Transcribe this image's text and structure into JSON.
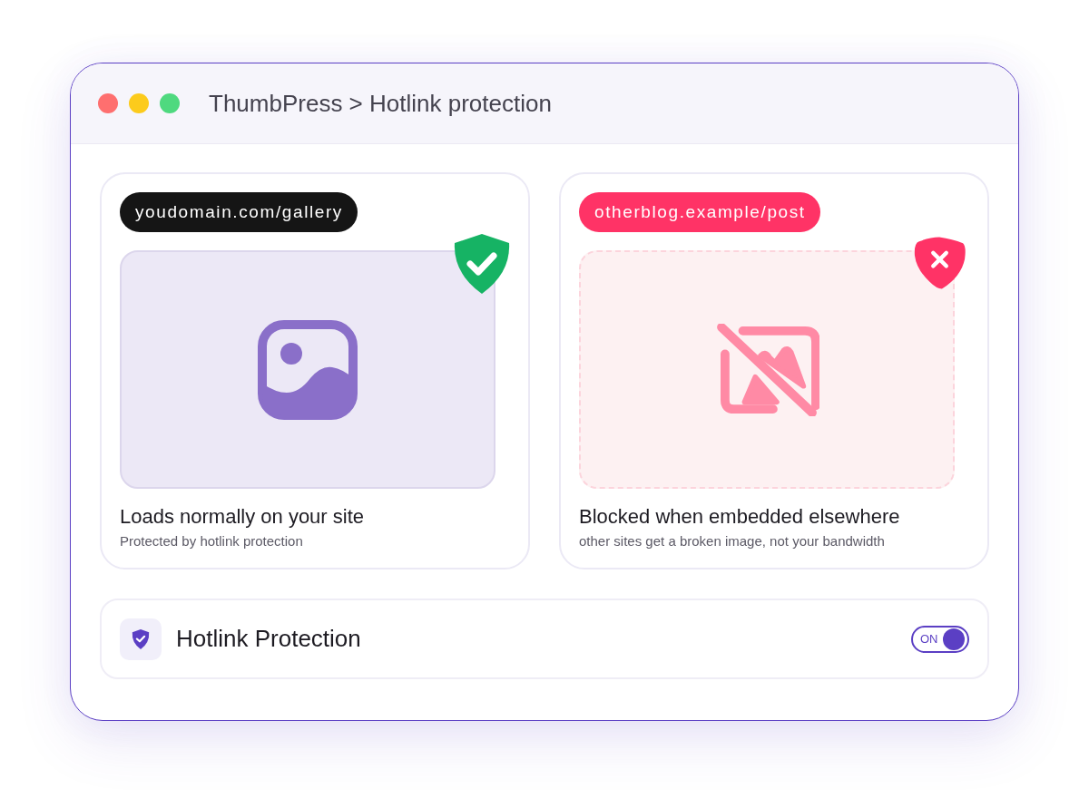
{
  "window": {
    "title": "ThumbPress > Hotlink protection"
  },
  "panels": [
    {
      "kind": "allowed",
      "url": "youdomain.com/gallery",
      "caption": "Loads normally on your site",
      "note": "Protected by hotlink protection"
    },
    {
      "kind": "blocked",
      "url": "otherblog.example/post",
      "caption": "Blocked when embedded elsewhere",
      "note": "other sites get a broken image, not your bandwidth"
    }
  ],
  "setting": {
    "label": "Hotlink Protection",
    "switch_text": "ON",
    "on": true
  }
}
